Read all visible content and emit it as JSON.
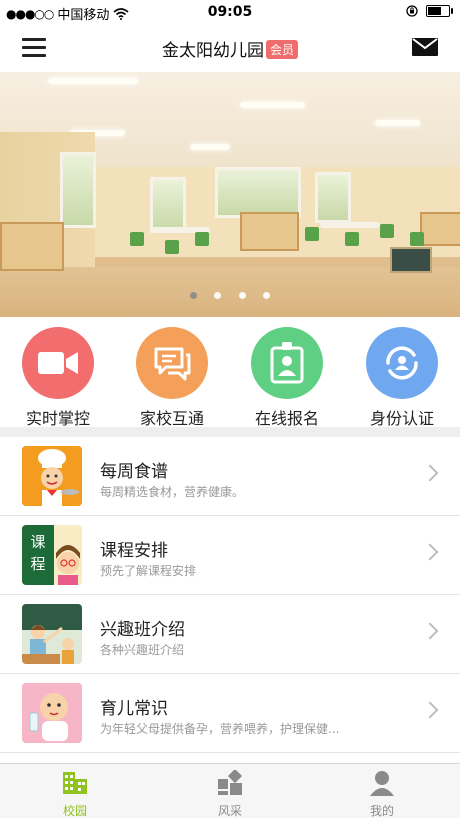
{
  "status_bar": {
    "carrier": "中国移动",
    "time": "09:05"
  },
  "header": {
    "title": "金太阳幼儿园",
    "badge": "会员"
  },
  "banner": {
    "pages": 4,
    "active_page": 1
  },
  "quick_actions": [
    {
      "label": "实时掌控",
      "color": "#f26d6d",
      "icon": "video-camera-icon"
    },
    {
      "label": "家校互通",
      "color": "#f5a05a",
      "icon": "chat-bubbles-icon"
    },
    {
      "label": "在线报名",
      "color": "#5fcf83",
      "icon": "id-badge-icon"
    },
    {
      "label": "身份认证",
      "color": "#6fa8ef",
      "icon": "identity-verify-icon"
    }
  ],
  "list": [
    {
      "title": "每周食谱",
      "subtitle": "每周精选食材，营养健康。"
    },
    {
      "title": "课程安排",
      "subtitle": "预先了解课程安排",
      "thumb_text": "课程"
    },
    {
      "title": "兴趣班介绍",
      "subtitle": "各种兴趣班介绍"
    },
    {
      "title": "育儿常识",
      "subtitle": "为年轻父母提供备孕，营养喂养，护理保健..."
    }
  ],
  "tabbar": [
    {
      "label": "校园",
      "active": true
    },
    {
      "label": "风采",
      "active": false
    },
    {
      "label": "我的",
      "active": false
    }
  ],
  "colors": {
    "accent": "#8fc31f",
    "badge": "#f06d6d"
  }
}
